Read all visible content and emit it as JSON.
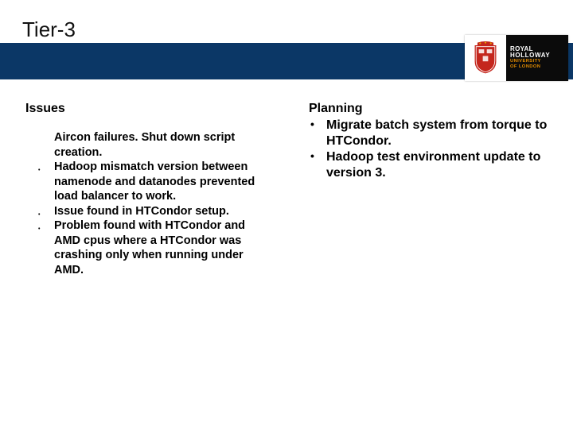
{
  "title": "Tier-3",
  "logo": {
    "line1": "ROYAL",
    "line2": "HOLLOWAY",
    "line3": "UNIVERSITY",
    "line4": "OF LONDON"
  },
  "left": {
    "heading": "Issues",
    "items": [
      "Aircon failures. Shut down script creation.",
      "Hadoop mismatch version between namenode and datanodes prevented load balancer to work.",
      "Issue found in HTCondor setup.",
      "Problem found with HTCondor and AMD cpus where a HTCondor was crashing only when running under AMD."
    ]
  },
  "right": {
    "heading": "Planning",
    "items": [
      "Migrate batch system from torque to HTCondor.",
      "Hadoop test environment update to version 3."
    ]
  }
}
